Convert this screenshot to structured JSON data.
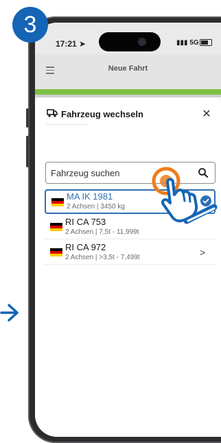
{
  "step": {
    "number": "3"
  },
  "status_bar": {
    "time": "17:21",
    "network": "5G"
  },
  "app": {
    "title": "Neue Fahrt"
  },
  "sheet": {
    "title": "Fahrzeug wechseln",
    "close_symbol": "✕",
    "search": {
      "placeholder": "Fahrzeug suchen"
    }
  },
  "vehicles": [
    {
      "plate": "MA IK 1981",
      "details": "2 Achsen | 3450 kg",
      "country": "DE",
      "selected": true
    },
    {
      "plate": "RI CA 753",
      "details": "2 Achsen | 7,5t - 11,999t",
      "country": "DE",
      "selected": false
    },
    {
      "plate": "RI CA 972",
      "details": "2 Achsen | >3,5t - 7,499t",
      "country": "DE",
      "selected": false
    }
  ],
  "icons": {
    "truck": "truck-icon",
    "search": "search-icon",
    "close": "close-icon",
    "check": "check-icon",
    "chevron": "chevron-right-icon",
    "hand": "tap-hand-icon",
    "arrow": "arrow-right-icon"
  },
  "colors": {
    "accent_blue": "#2f6fb4",
    "badge_blue": "#1565b6",
    "green_strip": "#7cc242",
    "ripple_orange": "#f07d1a"
  }
}
